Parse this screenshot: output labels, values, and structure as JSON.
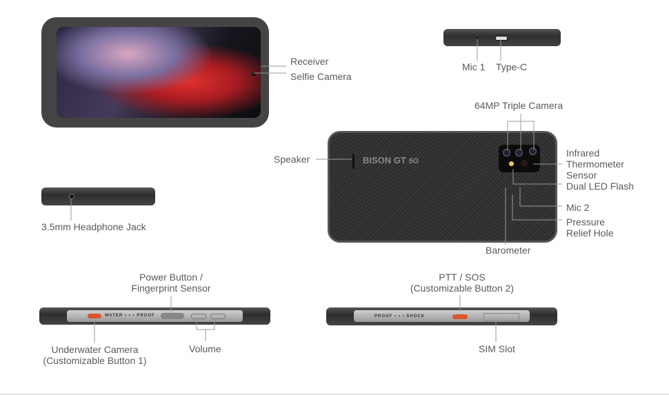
{
  "labels": {
    "receiver": "Receiver",
    "selfie_camera": "Selfie Camera",
    "mic1": "Mic 1",
    "type_c": "Type-C",
    "triple_camera": "64MP Triple Camera",
    "speaker": "Speaker",
    "infrared": [
      "Infrared",
      "Thermometer",
      "Sensor"
    ],
    "dual_led_flash": "Dual LED Flash",
    "mic2": "Mic 2",
    "pressure_relief": [
      "Pressure",
      "Relief Hole"
    ],
    "barometer": "Barometer",
    "headphone_jack": "3.5mm Headphone Jack",
    "power_button": [
      "Power Button /",
      "Fingerprint Sensor"
    ],
    "underwater_camera": [
      "Underwater Camera",
      "(Customizable Button 1)"
    ],
    "volume": "Volume",
    "ptt_sos": [
      "PTT / SOS",
      "(Customizable Button 2)"
    ],
    "sim_slot": "SIM Slot"
  },
  "branding": {
    "logo": "BISON GT",
    "logo_sub": "5G"
  },
  "side_text": {
    "left": "WATER  • • •  PROOF",
    "right": "PROOF • • • SHOCK"
  },
  "colors": {
    "accent_button": "#d9572b",
    "body": "#3b3b3b",
    "label": "#5a5a5a"
  }
}
